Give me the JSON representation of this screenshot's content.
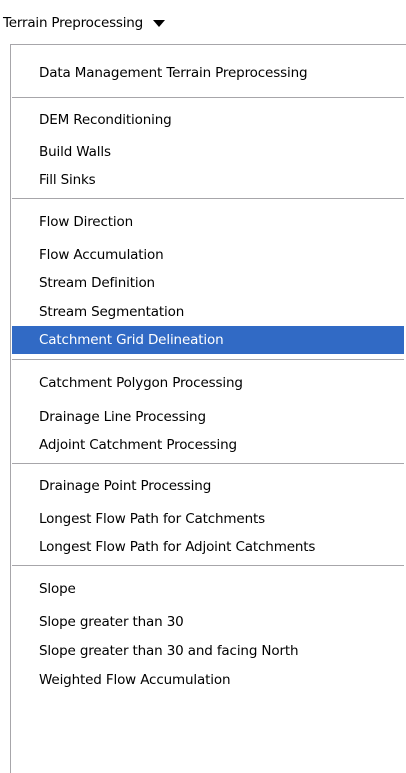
{
  "toolbar": {
    "menu_label": "Terrain Preprocessing"
  },
  "menu": {
    "groups": [
      {
        "items": [
          "Data Management Terrain Preprocessing"
        ]
      },
      {
        "items": [
          "DEM Reconditioning",
          "Build Walls",
          "Fill Sinks"
        ]
      },
      {
        "items": [
          "Flow Direction",
          "Flow Accumulation",
          "Stream Definition",
          "Stream Segmentation",
          "Catchment Grid Delineation"
        ]
      },
      {
        "items": [
          "Catchment Polygon Processing",
          "Drainage Line Processing",
          "Adjoint Catchment Processing"
        ]
      },
      {
        "items": [
          "Drainage Point Processing",
          "Longest Flow Path for Catchments",
          "Longest Flow Path for Adjoint Catchments"
        ]
      },
      {
        "items": [
          "Slope",
          "Slope greater than 30",
          "Slope greater than 30 and facing North",
          "Weighted Flow Accumulation"
        ]
      }
    ],
    "highlighted_item": "Catchment Grid Delineation"
  },
  "colors": {
    "highlight_bg": "#316ac5",
    "highlight_text": "#ffffff",
    "separator": "#a7a6aa"
  }
}
